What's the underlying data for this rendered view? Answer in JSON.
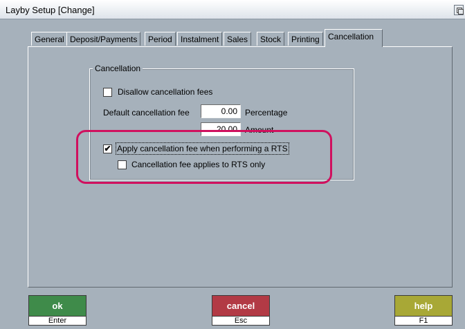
{
  "window": {
    "title": "Layby Setup  [Change]"
  },
  "tabs": [
    {
      "label": "General"
    },
    {
      "label": "Deposit/Payments"
    },
    {
      "label": "Period"
    },
    {
      "label": "Instalment"
    },
    {
      "label": "Sales"
    },
    {
      "label": "Stock"
    },
    {
      "label": "Printing"
    },
    {
      "label": "Cancellation",
      "active": true
    }
  ],
  "group": {
    "title": "Cancellation"
  },
  "fields": {
    "disallow_fees": {
      "label": "Disallow cancellation fees",
      "checked": false
    },
    "default_fee_label": "Default cancellation fee",
    "percentage": {
      "value": "0.00",
      "label": "Percentage"
    },
    "amount": {
      "value": "20.00",
      "label": "Amount"
    },
    "apply_rts": {
      "label": "Apply cancellation fee when performing a RTS",
      "checked": true
    },
    "rts_only": {
      "label": "Cancellation fee applies to RTS only",
      "checked": false
    }
  },
  "buttons": {
    "ok": {
      "label": "ok",
      "key": "Enter",
      "color": "#3f8b4a"
    },
    "cancel": {
      "label": "cancel",
      "key": "Esc",
      "color": "#b23a45"
    },
    "help": {
      "label": "help",
      "key": "F1",
      "color": "#a8a836"
    }
  },
  "colors": {
    "annotation": "#d0105e",
    "background": "#a6b1bb"
  },
  "check_mark": "✔"
}
